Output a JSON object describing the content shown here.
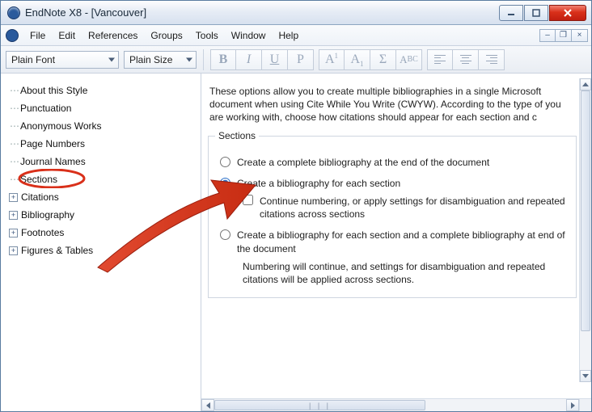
{
  "title": "EndNote X8 - [Vancouver]",
  "menus": [
    "File",
    "Edit",
    "References",
    "Groups",
    "Tools",
    "Window",
    "Help"
  ],
  "toolbar": {
    "font": "Plain Font",
    "size": "Plain Size",
    "fmt": {
      "bold": "B",
      "italic": "I",
      "underline": "U",
      "plain": "P",
      "sup": "A",
      "sup_i": "1",
      "sub": "A",
      "sub_i": "1",
      "sym": "Σ",
      "case": "A",
      "case_s": "BC"
    }
  },
  "tree": {
    "leaf": [
      "About this Style",
      "Punctuation",
      "Anonymous Works",
      "Page Numbers",
      "Journal Names",
      "Sections"
    ],
    "branch": [
      "Citations",
      "Bibliography",
      "Footnotes",
      "Figures & Tables"
    ]
  },
  "pane": {
    "intro": "These options allow you to create multiple bibliographies in a single Microsoft document when using Cite While You Write (CWYW). According to the type of you are working with, choose how citations should appear for each section and c",
    "legend": "Sections",
    "opt1": "Create a complete bibliography at the end of the document",
    "opt2": "Create a bibliography for each section",
    "opt2a": "Continue numbering, or apply settings for disambiguation and repeated citations across sections",
    "opt3": "Create a bibliography for each section and a complete bibliography at end of the document",
    "opt3a": "Numbering will continue, and settings for disambiguation and repeated citations will be applied across sections."
  }
}
